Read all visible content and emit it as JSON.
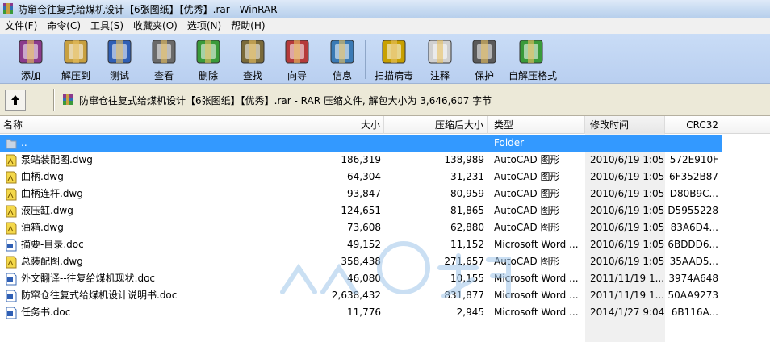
{
  "window": {
    "title": "防窜仓往复式给煤机设计【6张图纸】【优秀】.rar - WinRAR"
  },
  "menu": [
    {
      "label": "文件(F)"
    },
    {
      "label": "命令(C)"
    },
    {
      "label": "工具(S)"
    },
    {
      "label": "收藏夹(O)"
    },
    {
      "label": "选项(N)"
    },
    {
      "label": "帮助(H)"
    }
  ],
  "toolbar": [
    {
      "label": "添加",
      "icon": "add-archive-icon"
    },
    {
      "label": "解压到",
      "icon": "extract-to-icon"
    },
    {
      "label": "测试",
      "icon": "test-icon"
    },
    {
      "label": "查看",
      "icon": "view-icon"
    },
    {
      "label": "删除",
      "icon": "delete-icon"
    },
    {
      "label": "查找",
      "icon": "find-icon"
    },
    {
      "label": "向导",
      "icon": "wizard-icon"
    },
    {
      "label": "信息",
      "icon": "info-icon"
    },
    {
      "label": "扫描病毒",
      "icon": "virus-scan-icon"
    },
    {
      "label": "注释",
      "icon": "comment-icon"
    },
    {
      "label": "保护",
      "icon": "protect-icon"
    },
    {
      "label": "自解压格式",
      "icon": "sfx-icon"
    }
  ],
  "address": {
    "text": "防窜仓往复式给煤机设计【6张图纸】【优秀】.rar - RAR 压缩文件, 解包大小为 3,646,607 字节"
  },
  "columns": {
    "name": "名称",
    "size": "大小",
    "packed": "压缩后大小",
    "type": "类型",
    "modified": "修改时间",
    "crc": "CRC32"
  },
  "files": [
    {
      "name": "..",
      "size": "",
      "packed": "",
      "type": "Folder",
      "modified": "",
      "crc": "",
      "icon": "folder-up-icon"
    },
    {
      "name": "泵站装配图.dwg",
      "size": "186,319",
      "packed": "138,989",
      "type": "AutoCAD 图形",
      "modified": "2010/6/19 1:05",
      "crc": "572E910F",
      "icon": "dwg-file-icon"
    },
    {
      "name": "曲柄.dwg",
      "size": "64,304",
      "packed": "31,231",
      "type": "AutoCAD 图形",
      "modified": "2010/6/19 1:05",
      "crc": "6F352B87",
      "icon": "dwg-file-icon"
    },
    {
      "name": "曲柄连杆.dwg",
      "size": "93,847",
      "packed": "80,959",
      "type": "AutoCAD 图形",
      "modified": "2010/6/19 1:05",
      "crc": "D80B9C...",
      "icon": "dwg-file-icon"
    },
    {
      "name": "液压缸.dwg",
      "size": "124,651",
      "packed": "81,865",
      "type": "AutoCAD 图形",
      "modified": "2010/6/19 1:05",
      "crc": "D5955228",
      "icon": "dwg-file-icon"
    },
    {
      "name": "油箱.dwg",
      "size": "73,608",
      "packed": "62,880",
      "type": "AutoCAD 图形",
      "modified": "2010/6/19 1:05",
      "crc": "83A6D4...",
      "icon": "dwg-file-icon"
    },
    {
      "name": "摘要-目录.doc",
      "size": "49,152",
      "packed": "11,152",
      "type": "Microsoft Word ...",
      "modified": "2010/6/19 1:05",
      "crc": "6BDDD6...",
      "icon": "doc-file-icon"
    },
    {
      "name": "总装配图.dwg",
      "size": "358,438",
      "packed": "271,657",
      "type": "AutoCAD 图形",
      "modified": "2010/6/19 1:05",
      "crc": "35AAD5...",
      "icon": "dwg-file-icon"
    },
    {
      "name": "外文翻译--往复给煤机现状.doc",
      "size": "46,080",
      "packed": "10,155",
      "type": "Microsoft Word ...",
      "modified": "2011/11/19 1...",
      "crc": "3974A648",
      "icon": "doc-file-icon"
    },
    {
      "name": "防窜仓往复式给煤机设计说明书.doc",
      "size": "2,638,432",
      "packed": "831,877",
      "type": "Microsoft Word ...",
      "modified": "2011/11/19 1...",
      "crc": "50AA9273",
      "icon": "doc-file-icon"
    },
    {
      "name": "任务书.doc",
      "size": "11,776",
      "packed": "2,945",
      "type": "Microsoft Word ...",
      "modified": "2014/1/27 9:04",
      "crc": "6B116A...",
      "icon": "doc-file-icon"
    }
  ],
  "colors": {
    "selection": "#3399ff",
    "toolbar_bg": "#c9dcf6",
    "titlebar_bg": "#c9dcf2"
  }
}
